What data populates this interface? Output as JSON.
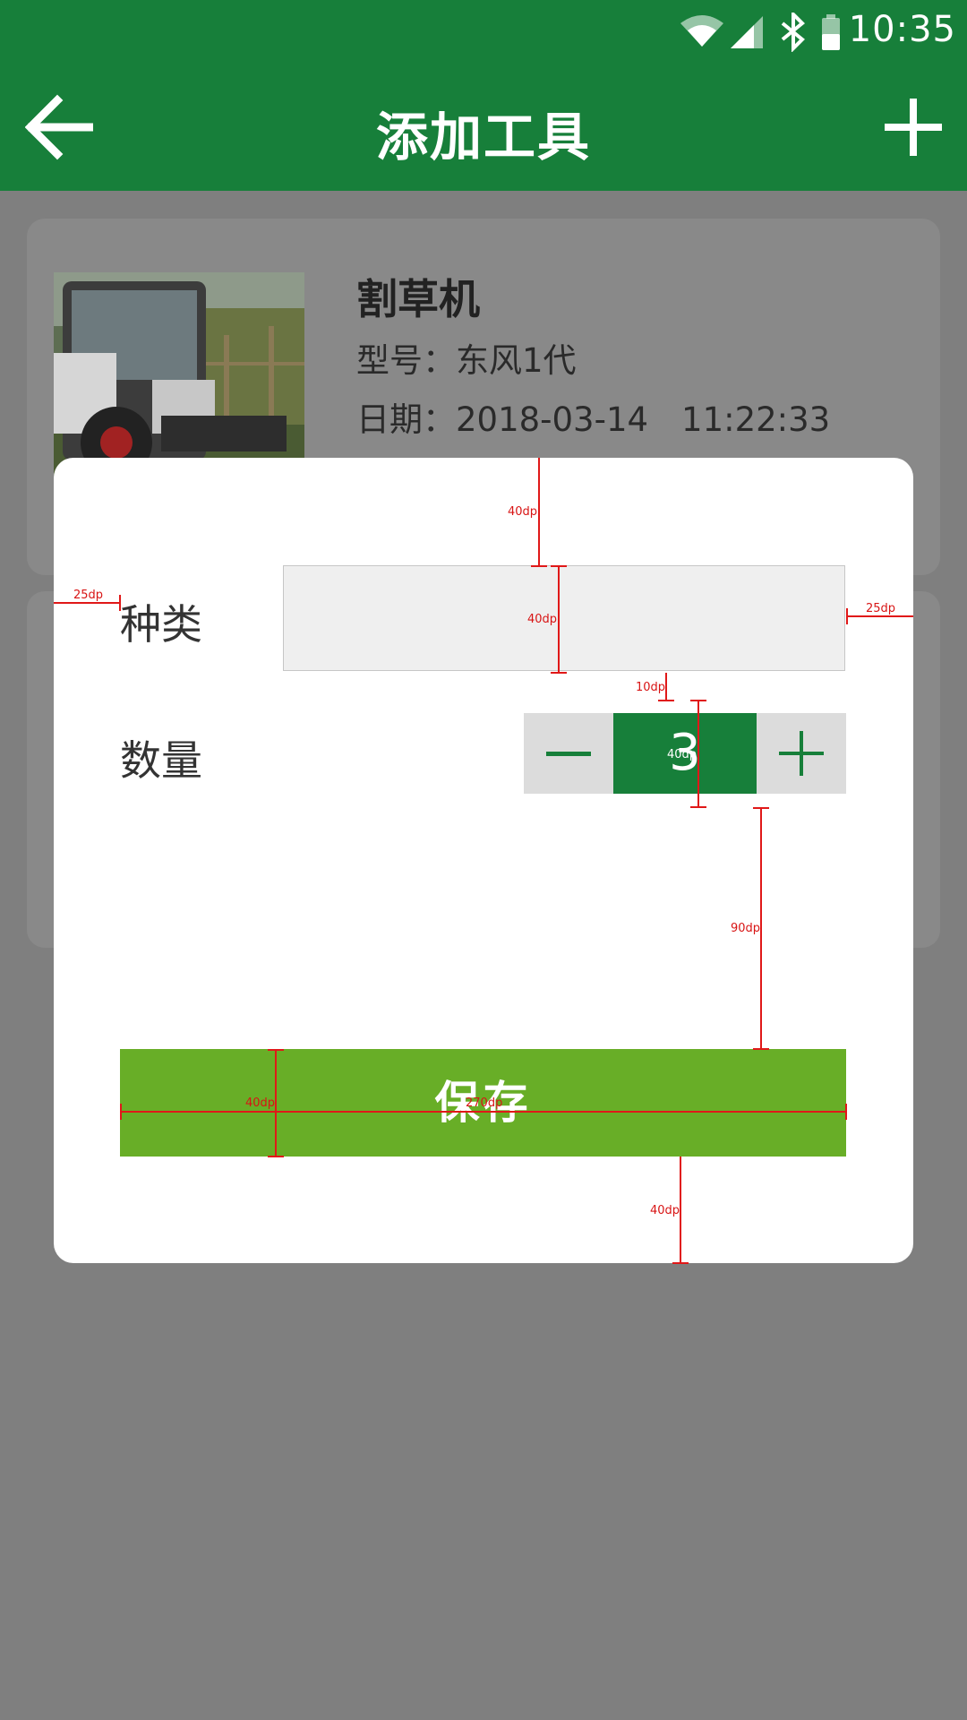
{
  "status_bar": {
    "time": "10:35",
    "icons": [
      "wifi-icon",
      "signal-icon",
      "bluetooth-icon",
      "battery-icon"
    ]
  },
  "header": {
    "title": "添加工具",
    "back_icon": "arrow-left-icon",
    "add_icon": "plus-icon"
  },
  "card": {
    "name": "割草机",
    "model": "型号：东风1代",
    "date": "日期：2018-03-14　11:22:33"
  },
  "dialog": {
    "type_label": "种类",
    "type_value": "",
    "quantity_label": "数量",
    "quantity_value": "3",
    "minus_icon": "minus-icon",
    "plus_icon": "plus-icon",
    "save_label": "保存"
  },
  "annotations": {
    "top_gap": "40dp",
    "left_margin": "25dp",
    "input_height": "40dp",
    "right_margin": "25dp",
    "field_gap": "10dp",
    "stepper_height": "40dp",
    "save_gap": "90dp",
    "button_height": "40dp",
    "button_width": "270dp",
    "bottom_gap": "40dp"
  },
  "colors": {
    "brand_green": "#177f3a",
    "button_green": "#68ae27",
    "overlay": "#7f7f7f"
  }
}
